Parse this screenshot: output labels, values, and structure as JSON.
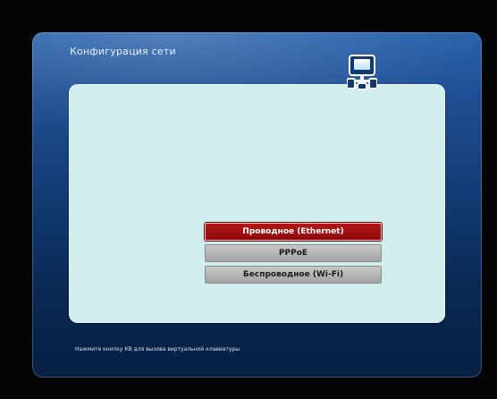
{
  "window": {
    "title": "Конфигурация сети"
  },
  "header_icon": "network-config-icon",
  "menu": {
    "items": [
      {
        "label": "Проводное (Ethernet)",
        "selected": true
      },
      {
        "label": "PPPoE",
        "selected": false
      },
      {
        "label": "Беспроводное (Wi-Fi)",
        "selected": false
      }
    ]
  },
  "footer": {
    "hint": "Нажмите кнопку КВ для вызова виртуальной клавиатуры"
  },
  "colors": {
    "frame_blue": "#1f4f92",
    "panel_bg": "#d2eded",
    "selected_red": "#a31010",
    "item_gray": "#b4b4b4"
  }
}
